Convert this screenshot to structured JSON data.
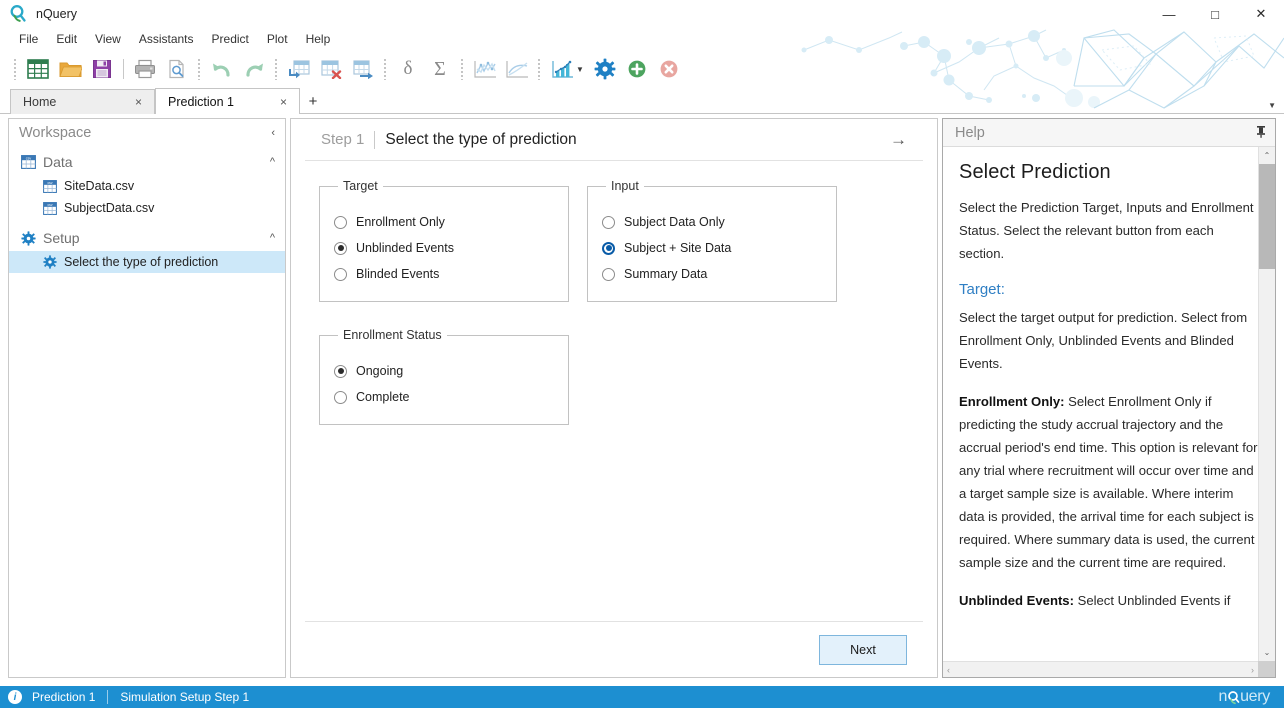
{
  "window": {
    "title": "nQuery",
    "logo_icon": "nquery-magnifier-icon",
    "minimize_label": "—",
    "maximize_label": "□",
    "close_label": "✕"
  },
  "menubar": {
    "items": [
      {
        "label": "File"
      },
      {
        "label": "Edit"
      },
      {
        "label": "View"
      },
      {
        "label": "Assistants"
      },
      {
        "label": "Predict"
      },
      {
        "label": "Plot"
      },
      {
        "label": "Help"
      }
    ]
  },
  "toolbar": {
    "buttons": [
      {
        "name": "new-table-icon",
        "title": "New"
      },
      {
        "name": "open-folder-icon",
        "title": "Open"
      },
      {
        "name": "save-floppy-icon",
        "title": "Save"
      },
      {
        "name": "print-icon",
        "title": "Print"
      },
      {
        "name": "print-preview-icon",
        "title": "Print Preview"
      },
      {
        "name": "undo-icon",
        "title": "Undo"
      },
      {
        "name": "redo-icon",
        "title": "Redo"
      },
      {
        "name": "insert-row-icon",
        "title": "Insert Row"
      },
      {
        "name": "delete-row-icon",
        "title": "Delete Row"
      },
      {
        "name": "move-row-icon",
        "title": "Move Row"
      },
      {
        "name": "delta-icon",
        "title": "Delta"
      },
      {
        "name": "sigma-icon",
        "title": "Sigma"
      },
      {
        "name": "line-plot-icon",
        "title": "Line Plot"
      },
      {
        "name": "curve-plot-icon",
        "title": "Curve Plot"
      },
      {
        "name": "bar-chart-icon",
        "title": "Chart"
      },
      {
        "name": "chart-dropdown-caret-icon",
        "title": "Chart options"
      },
      {
        "name": "settings-gear-icon",
        "title": "Settings"
      },
      {
        "name": "add-green-icon",
        "title": "Add"
      },
      {
        "name": "remove-red-icon",
        "title": "Remove"
      }
    ]
  },
  "tabs": {
    "items": [
      {
        "label": "Home",
        "active": false,
        "close": "×"
      },
      {
        "label": "Prediction 1",
        "active": true,
        "close": "×"
      }
    ],
    "add_label": "+",
    "overflow_caret": "▼"
  },
  "sidebar": {
    "header": "Workspace",
    "collapse_caret": "‹",
    "groups": [
      {
        "label": "Data",
        "icon": "csv-file-icon",
        "caret": "^",
        "children": [
          {
            "label": "SiteData.csv",
            "icon": "csv-file-icon",
            "selected": false
          },
          {
            "label": "SubjectData.csv",
            "icon": "csv-file-icon",
            "selected": false
          }
        ]
      },
      {
        "label": "Setup",
        "icon": "gear-icon",
        "caret": "^",
        "children": [
          {
            "label": "Select the type of prediction",
            "icon": "gear-icon",
            "selected": true
          }
        ]
      }
    ]
  },
  "step": {
    "number_label": "Step 1",
    "title": "Select the type of prediction",
    "forward_arrow": "→"
  },
  "form": {
    "groups": [
      {
        "key": "target",
        "legend": "Target",
        "options": [
          {
            "label": "Enrollment Only",
            "checked": false,
            "focus": false
          },
          {
            "label": "Unblinded Events",
            "checked": true,
            "focus": false
          },
          {
            "label": "Blinded Events",
            "checked": false,
            "focus": false
          }
        ]
      },
      {
        "key": "input",
        "legend": "Input",
        "options": [
          {
            "label": "Subject Data Only",
            "checked": false,
            "focus": false
          },
          {
            "label": "Subject + Site Data",
            "checked": true,
            "focus": true
          },
          {
            "label": "Summary Data",
            "checked": false,
            "focus": false
          }
        ]
      },
      {
        "key": "status",
        "legend": "Enrollment Status",
        "options": [
          {
            "label": "Ongoing",
            "checked": true,
            "focus": false
          },
          {
            "label": "Complete",
            "checked": false,
            "focus": false
          }
        ]
      }
    ],
    "next_label": "Next"
  },
  "help": {
    "panel_title": "Help",
    "pin_icon": "pin-icon",
    "heading": "Select Prediction",
    "intro": "Select the Prediction Target, Inputs and Enrollment Status. Select the relevant button from each section.",
    "section_target": "Target:",
    "target_desc": "Select the target output for prediction. Select from Enrollment Only, Unblinded Events and Blinded Events.",
    "enrollment_only_term": "Enrollment Only:",
    "enrollment_only_desc": " Select Enrollment Only if predicting the study accrual trajectory and the accrual period's end time. This option is relevant for any trial where recruitment will occur over time and a target sample size is available. Where interim data is provided, the arrival time for each subject is required. Where summary data is used, the current sample size and the current time are required.",
    "unblinded_term": "Unblinded Events:",
    "unblinded_desc": " Select Unblinded Events if",
    "scroll_up": "⌃",
    "scroll_down": "⌄",
    "scroll_left": "‹",
    "scroll_right": "›"
  },
  "statusbar": {
    "info_icon": "info-icon",
    "info_glyph": "i",
    "context": "Prediction 1",
    "message": "Simulation Setup Step 1",
    "brand_prefix": "n",
    "brand_suffix": "uery",
    "brand_icon": "nquery-magnifier-icon"
  },
  "colors": {
    "accent_blue": "#1d8fd1",
    "selection_blue": "#cde8f9",
    "help_link_blue": "#2f7fc4",
    "button_fill": "#e3f1fb",
    "button_border": "#7eb6dd"
  }
}
